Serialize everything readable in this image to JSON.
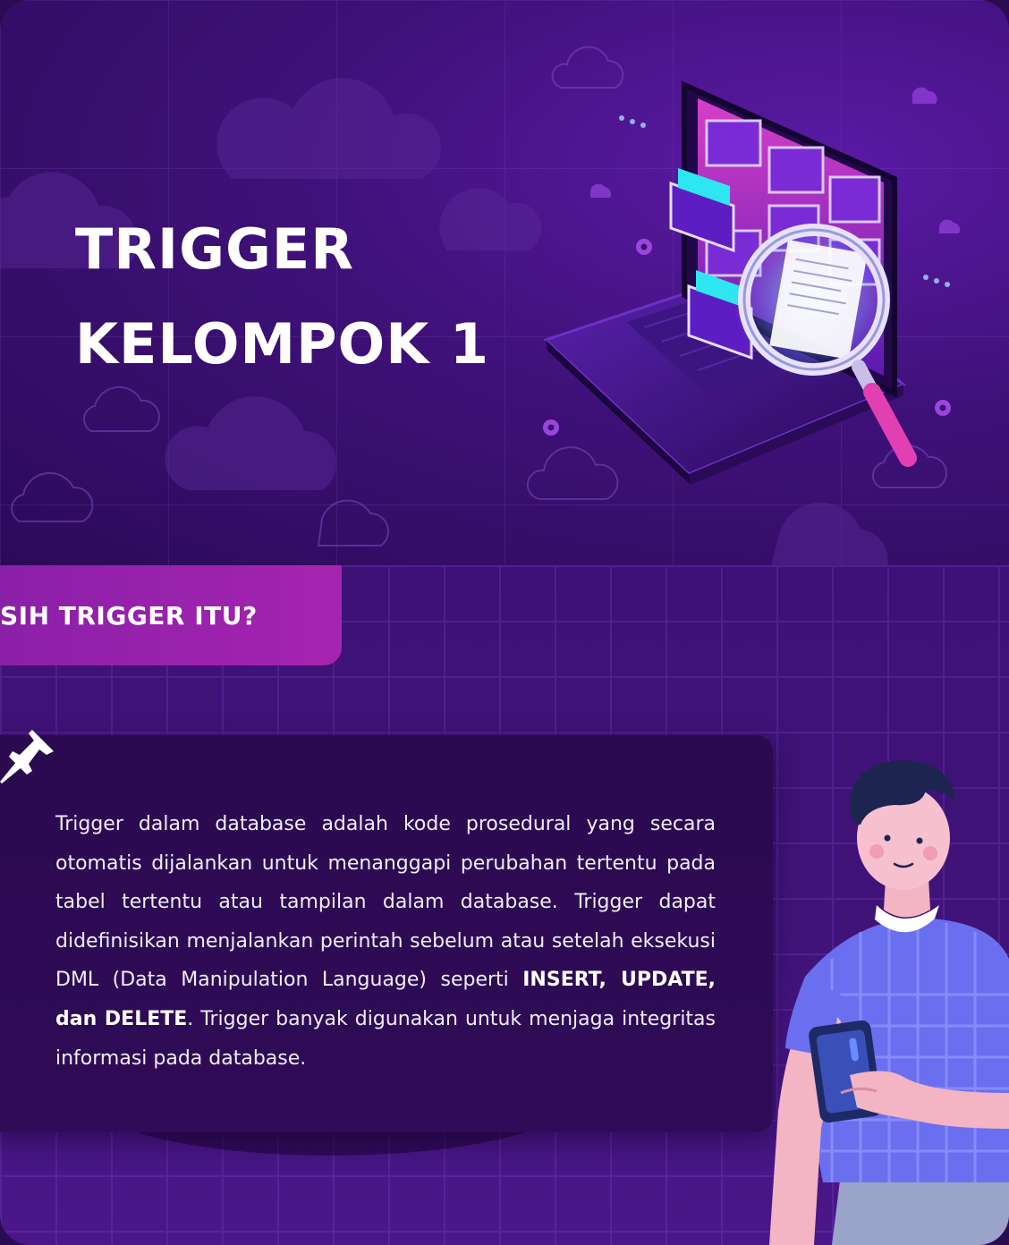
{
  "hero": {
    "title_line1": "TRIGGER",
    "title_line2": "KELOMPOK 1"
  },
  "question": {
    "label": "SIH TRIGGER ITU?"
  },
  "description": {
    "part1": "Trigger dalam database adalah kode prosedural yang secara otomatis dijalankan untuk menanggapi perubahan tertentu pada tabel tertentu atau tampilan dalam database. Trigger dapat didefinisikan menjalankan perintah sebelum atau setelah eksekusi DML (Data Manipulation Language) seperti ",
    "bold": "INSERT, UPDATE, dan DELETE",
    "part2": ". Trigger banyak digunakan untuk menjaga integritas informasi pada database."
  },
  "colors": {
    "background": "#3a0f6e",
    "accent_tab": "#a524b0",
    "card": "#2d0a52",
    "text": "#ffffff",
    "shirt": "#6a6ff0",
    "magnifier": "#e23fb3"
  },
  "icons": [
    "pin-icon",
    "cloud-icon",
    "gear-icon",
    "laptop-illustration",
    "magnifier-illustration",
    "person-illustration"
  ]
}
